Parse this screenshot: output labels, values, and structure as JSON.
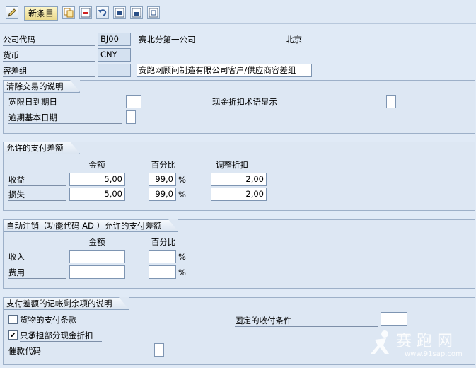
{
  "toolbar": {
    "new_entries_label": "新条目",
    "icons": [
      "edit-icon",
      "copy-icon",
      "delete-icon",
      "undo-icon",
      "select-all-icon",
      "select-block-icon",
      "deselect-all-icon"
    ]
  },
  "header": {
    "company_code_label": "公司代码",
    "company_code_value": "BJ00",
    "company_name": "赛北分第一公司",
    "company_city": "北京",
    "currency_label": "货币",
    "currency_value": "CNY",
    "tolerance_group_label": "容差组",
    "tolerance_group_value": "",
    "tolerance_group_desc": "赛跑网顾问制造有限公司客户/供应商容差组"
  },
  "clearing": {
    "title": "清除交易的说明",
    "grace_days_label": "宽限日到期日",
    "grace_days_value": "",
    "cash_discount_terms_label": "现金折扣术语显示",
    "cash_discount_terms_value": "",
    "arrears_base_date_label": "逾期基本日期",
    "arrears_base_date_value": ""
  },
  "payment_diff": {
    "title": "允许的支付差额",
    "col_amount": "金额",
    "col_percent": "百分比",
    "col_adjust_discount": "调整折扣",
    "percent_sign": "%",
    "rows": [
      {
        "label": "收益",
        "amount": "5,00",
        "percent": "99,0",
        "adjust": "2,00"
      },
      {
        "label": "损失",
        "amount": "5,00",
        "percent": "99,0",
        "adjust": "2,00"
      }
    ]
  },
  "auto_writeoff": {
    "title": "自动注销（功能代码 AD ）允许的支付差额",
    "col_amount": "金额",
    "col_percent": "百分比",
    "percent_sign": "%",
    "rows": [
      {
        "label": "收入",
        "amount": "",
        "percent": ""
      },
      {
        "label": "费用",
        "amount": "",
        "percent": ""
      }
    ]
  },
  "posting": {
    "title": "支付差额的记帐剩余项的说明",
    "goods_terms_label": "货物的支付条款",
    "goods_terms_checked": false,
    "fixed_terms_label": "固定的收付条件",
    "fixed_terms_value": "",
    "partial_discount_label": "只承担部分现金折扣",
    "partial_discount_checked": true,
    "dunning_key_label": "催款代码",
    "dunning_key_value": ""
  },
  "watermark": {
    "text": "赛 跑 网",
    "url": "www.91sap.com"
  }
}
